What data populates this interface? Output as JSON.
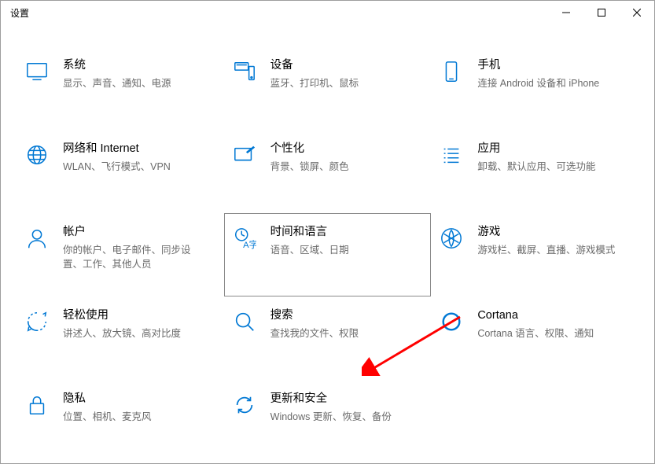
{
  "window": {
    "title": "设置"
  },
  "buttons": {
    "min": "—",
    "max": "☐",
    "close": "✕"
  },
  "tiles": {
    "system": {
      "name": "系统",
      "desc": "显示、声音、通知、电源"
    },
    "devices": {
      "name": "设备",
      "desc": "蓝牙、打印机、鼠标"
    },
    "phone": {
      "name": "手机",
      "desc": "连接 Android 设备和 iPhone"
    },
    "network": {
      "name": "网络和 Internet",
      "desc": "WLAN、飞行模式、VPN"
    },
    "personal": {
      "name": "个性化",
      "desc": "背景、锁屏、颜色"
    },
    "apps": {
      "name": "应用",
      "desc": "卸载、默认应用、可选功能"
    },
    "accounts": {
      "name": "帐户",
      "desc": "你的帐户、电子邮件、同步设置、工作、其他人员"
    },
    "timelang": {
      "name": "时间和语言",
      "desc": "语音、区域、日期"
    },
    "gaming": {
      "name": "游戏",
      "desc": "游戏栏、截屏、直播、游戏模式"
    },
    "ease": {
      "name": "轻松使用",
      "desc": "讲述人、放大镜、高对比度"
    },
    "search": {
      "name": "搜索",
      "desc": "查找我的文件、权限"
    },
    "cortana": {
      "name": "Cortana",
      "desc": "Cortana 语言、权限、通知"
    },
    "privacy": {
      "name": "隐私",
      "desc": "位置、相机、麦克风"
    },
    "update": {
      "name": "更新和安全",
      "desc": "Windows 更新、恢复、备份"
    }
  },
  "colors": {
    "accent": "#0078d4",
    "muted": "#6a6a6a"
  }
}
